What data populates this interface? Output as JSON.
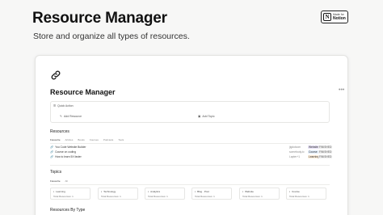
{
  "hero": {
    "title": "Resource Manager",
    "subtitle": "Store and organize all types of resources.",
    "badge_small": "Made for",
    "badge_big": "Notion"
  },
  "page": {
    "title": "Resource Manager",
    "more": "•••"
  },
  "quick_action": {
    "label": "Quick Action",
    "add_resource": "Add Resource",
    "add_topic": "Add Topic"
  },
  "resources": {
    "heading": "Resources",
    "tabs": [
      "Favourite",
      "Articles",
      "Books",
      "Courses",
      "Podcasts",
      "Tools"
    ],
    "rows": [
      {
        "name": "You Code Website Builder",
        "meta": "jigdotcom",
        "tag": "Website",
        "tag_color": "#e8e2f7",
        "status": "FINISHED"
      },
      {
        "name": "Course on coding",
        "meta": "somebody.io",
        "tag": "Course",
        "tag_color": "#e3eefb",
        "status": "FINISHED"
      },
      {
        "name": "How to learn 5X faster",
        "meta": "Lapter+1",
        "tag": "Learning",
        "tag_color": "#fbecd9",
        "status": "FINISHED"
      }
    ]
  },
  "topics": {
    "heading": "Topics",
    "tabs": [
      "Favourite",
      "All"
    ],
    "cards": [
      {
        "name": "Learning",
        "count": "Total Resources: 1"
      },
      {
        "name": "Technology",
        "count": "Total Resources: 1"
      },
      {
        "name": "Analytics",
        "count": "Total Resources: 1"
      },
      {
        "name": "Blog · Post",
        "count": "Total Resources: 1"
      },
      {
        "name": "Website",
        "count": "Total Resources: 1"
      },
      {
        "name": "Course",
        "count": "Total Resources: 1"
      }
    ]
  },
  "by_type": {
    "heading": "Resources By Type"
  }
}
